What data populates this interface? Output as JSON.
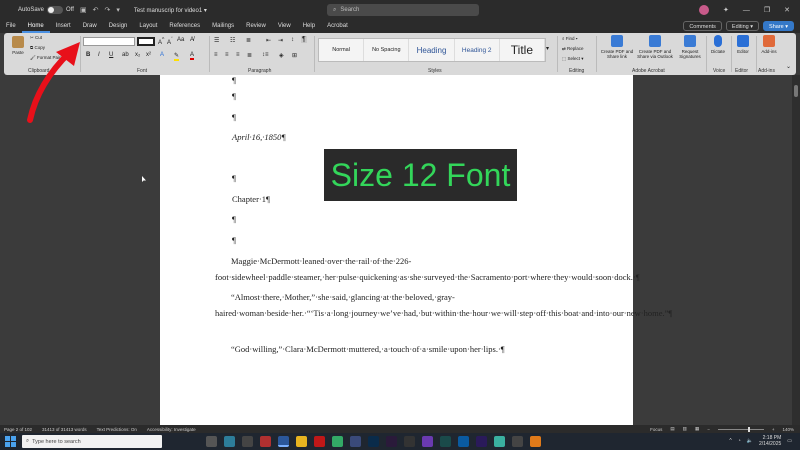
{
  "titlebar": {
    "autosave_label": "AutoSave",
    "autosave_state": "Off",
    "document_title": "Test manuscrip for video1 ▾",
    "search_placeholder": "Search"
  },
  "menu": {
    "tabs": [
      "File",
      "Home",
      "Insert",
      "Draw",
      "Design",
      "Layout",
      "References",
      "Mailings",
      "Review",
      "View",
      "Help",
      "Acrobat"
    ],
    "active_tab": "Home",
    "comments_label": "Comments",
    "editing_label": "Editing ▾",
    "share_label": "Share ▾"
  },
  "ribbon": {
    "clipboard": {
      "paste": "Paste",
      "cut": "Cut",
      "copy": "Copy",
      "format_painter": "Format Painter",
      "label": "Clipboard"
    },
    "font": {
      "label": "Font",
      "font_name": "",
      "font_size": "",
      "bold": "B",
      "italic": "I",
      "underline": "U"
    },
    "paragraph": {
      "label": "Paragraph",
      "pilcrow": "¶"
    },
    "styles": {
      "label": "Styles",
      "items": [
        "Normal",
        "No Spacing",
        "Heading",
        "Heading 2",
        "Title"
      ]
    },
    "editing": {
      "label": "Editing",
      "find": "Find ▾",
      "replace": "Replace",
      "select": "Select ▾"
    },
    "acrobat": {
      "label": "Adobe Acrobat",
      "create_pdf_share": "Create PDF and Share link",
      "create_pdf_outlook": "Create PDF and Share via Outlook",
      "request_signatures": "Request Signatures"
    },
    "voice": {
      "label": "Voice",
      "dictate": "Dictate"
    },
    "editor": {
      "label": "Editor",
      "editor": "Editor"
    },
    "addins": {
      "label": "Add-ins",
      "addins": "Add-ins"
    }
  },
  "document": {
    "empty_marks": [
      "¶",
      "¶",
      "¶"
    ],
    "date_line": "April·16,·1850¶",
    "blank_after_date": "¶",
    "chapter": "Chapter·1¶",
    "blank_after_chapter": [
      "¶",
      "¶"
    ],
    "paragraphs": [
      "Maggie·McDermott·leaned·over·the·rail·of·the·226-foot·sidewheel·paddle·steamer,·her·pulse·quickening·as·she·surveyed·the·Sacramento·port·where·they·would·soon·dock.·¶",
      "“Almost·there,·Mother,”·she·said,·glancing·at·the·beloved,·gray-haired·woman·beside·her.·“‘Tis·a·long·journey·we’ve·had,·but·within·the·hour·we·will·step·off·this·boat·and·into·our·new·home.”¶",
      "“God·willing,”·Clara·McDermott·muttered,·a·touch·of·a·smile·upon·her·lips.·¶"
    ]
  },
  "overlay": {
    "text": "Size 12 Font",
    "text_color": "#33d65a",
    "bg_color": "#2a2a2a"
  },
  "annotation": {
    "arrow_color": "#e8101a"
  },
  "statusbar": {
    "page": "Page 2 of 102",
    "words": "31413 of 31413 words",
    "text_predictions": "Text Predictions: On",
    "accessibility": "Accessibility: Investigate",
    "focus": "Focus",
    "zoom": "140%"
  },
  "taskbar": {
    "search_placeholder": "Type here to search",
    "time": "2:18 PM",
    "date": "2/14/2025"
  }
}
